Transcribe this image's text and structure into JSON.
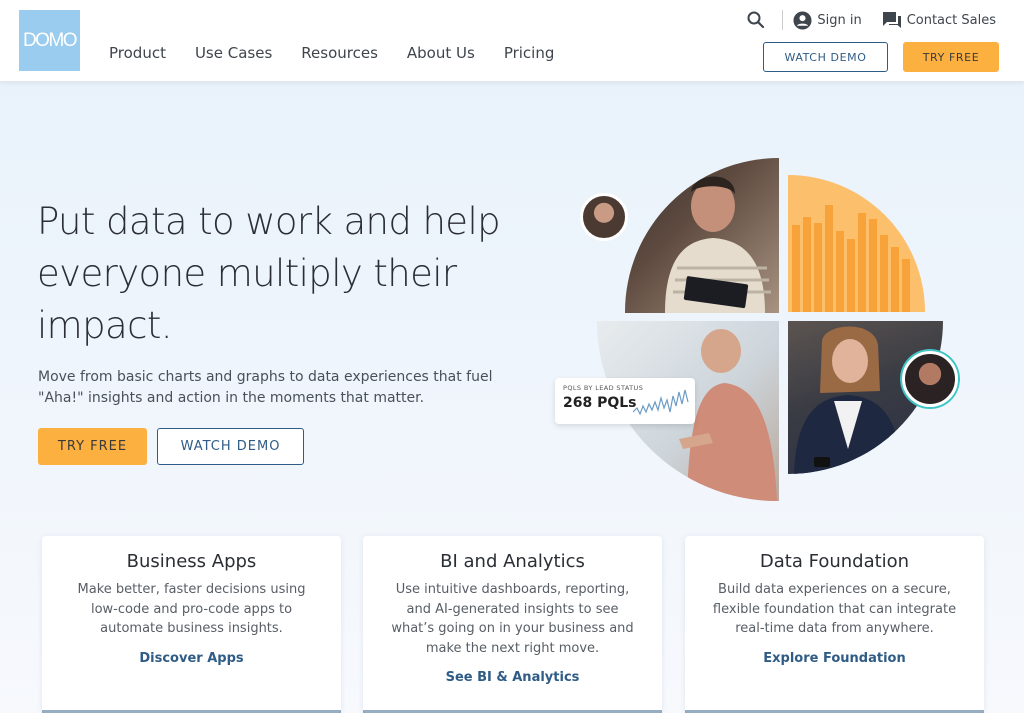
{
  "header": {
    "logo_text": "DOMO",
    "nav": [
      "Product",
      "Use Cases",
      "Resources",
      "About Us",
      "Pricing"
    ],
    "sign_in": "Sign in",
    "contact_sales": "Contact Sales",
    "watch_demo": "WATCH DEMO",
    "try_free": "TRY FREE"
  },
  "hero": {
    "title": "Put data to work and help everyone multiply their impact.",
    "subtitle": "Move from basic charts and graphs to data experiences that fuel \"Aha!\" insights and action in the moments that matter.",
    "try_free": "TRY FREE",
    "watch_demo": "WATCH DEMO",
    "pql_label": "PQLS BY LEAD STATUS",
    "pql_value": "268 PQLs"
  },
  "cards": [
    {
      "title": "Business Apps",
      "text": "Make better, faster decisions using low-code and pro-code apps to automate business insights.",
      "link": "Discover Apps"
    },
    {
      "title": "BI and Analytics",
      "text": "Use intuitive dashboards, reporting, and AI-generated insights to see what’s going on in your business and make the next right move.",
      "link": "See BI & Analytics"
    },
    {
      "title": "Data Foundation",
      "text": "Build data experiences on a secure, flexible foundation that can integrate real-time data from anywhere.",
      "link": "Explore Foundation"
    }
  ],
  "colors": {
    "brand": "#99ccee",
    "accent": "#fbb040",
    "link": "#2f5c86"
  }
}
